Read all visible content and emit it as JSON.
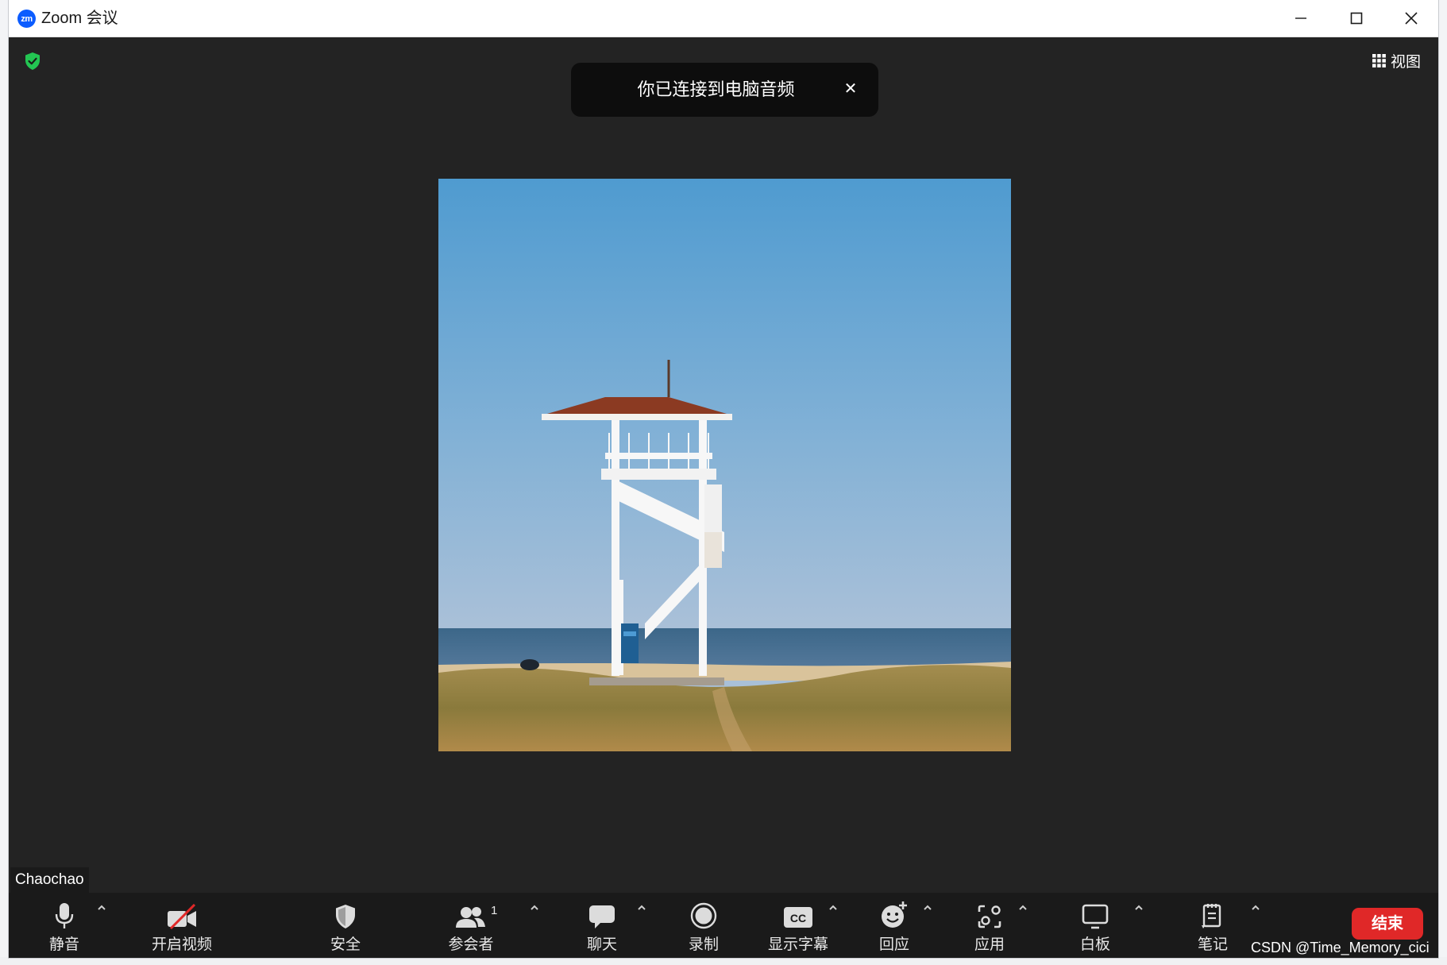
{
  "window": {
    "app_logo_text": "zm",
    "title": "Zoom 会议"
  },
  "header": {
    "view_label": "视图"
  },
  "toast": {
    "message": "你已连接到电脑音频",
    "close_symbol": "✕"
  },
  "participant": {
    "name": "Chaochao"
  },
  "toolbar": {
    "mute_label": "静音",
    "video_label": "开启视频",
    "security_label": "安全",
    "participants_label": "参会者",
    "participants_count": "1",
    "chat_label": "聊天",
    "record_label": "录制",
    "captions_label": "显示字幕",
    "captions_icon_text": "CC",
    "reactions_label": "回应",
    "apps_label": "应用",
    "whiteboard_label": "白板",
    "notes_label": "笔记",
    "end_label": "结束"
  },
  "watermark": "CSDN @Time_Memory_cici",
  "colors": {
    "meeting_bg": "#232323",
    "toolbar_bg": "#1a1a1a",
    "end_button": "#e02828",
    "security_green": "#23c552",
    "zoom_blue": "#0b5cff"
  },
  "icons": [
    "zoom-logo-icon",
    "minimize-icon",
    "maximize-icon",
    "close-icon",
    "security-shield-icon",
    "grid-view-icon",
    "microphone-icon",
    "video-off-icon",
    "shield-icon",
    "participants-icon",
    "chat-icon",
    "record-icon",
    "captions-icon",
    "reactions-icon",
    "apps-icon",
    "whiteboard-icon",
    "notes-icon",
    "caret-up-icon"
  ]
}
